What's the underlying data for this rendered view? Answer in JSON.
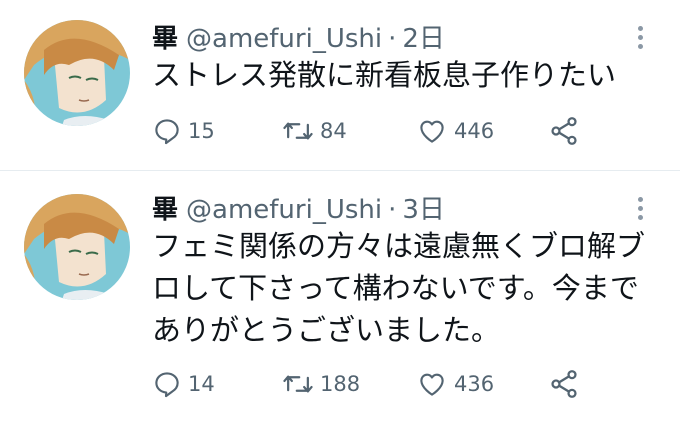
{
  "tweets": [
    {
      "display_name": "畢",
      "handle": "@amefuri_Ushi",
      "separator": "·",
      "time": "2日",
      "lines": [
        "ストレス発散に新看板息子作りたい"
      ],
      "replies": "15",
      "retweets": "84",
      "likes": "446"
    },
    {
      "display_name": "畢",
      "handle": "@amefuri_Ushi",
      "separator": "·",
      "time": "3日",
      "lines": [
        "フェミ関係の方々は遠慮無くブロ解ブ",
        "ロして下さって構わないです。今まで",
        "ありがとうございました。"
      ],
      "replies": "14",
      "retweets": "188",
      "likes": "436"
    }
  ],
  "colors": {
    "text": "#0f1419",
    "secondary": "#536471",
    "divider": "#e6ecf0",
    "avatar_bg": "#7ec8d6",
    "avatar_hair": "#d9a55e"
  },
  "icons": [
    "reply-icon",
    "retweet-icon",
    "like-icon",
    "share-icon",
    "more-options-icon",
    "avatar"
  ]
}
